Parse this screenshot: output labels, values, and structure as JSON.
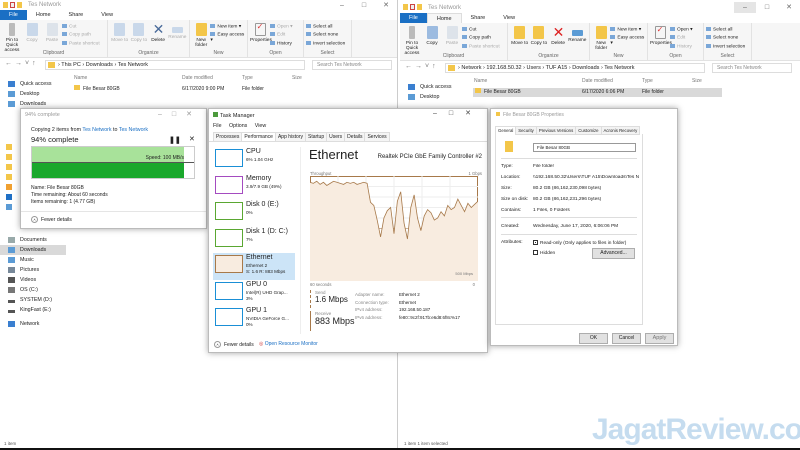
{
  "left_explorer": {
    "title": "Tes Network",
    "tabs": [
      "File",
      "Home",
      "Share",
      "View"
    ],
    "ribbon": {
      "clipboard": {
        "label": "Clipboard",
        "pin": "Pin to Quick access",
        "copy": "Copy",
        "paste": "Paste",
        "cut": "Cut",
        "copy_path": "Copy path",
        "paste_shortcut": "Paste shortcut"
      },
      "organize": {
        "label": "Organize",
        "move_to": "Move to",
        "copy_to": "Copy to",
        "delete": "Delete",
        "rename": "Rename"
      },
      "new": {
        "label": "New",
        "new_folder": "New folder",
        "new_item": "New item ▾",
        "easy_access": "Easy access ▾"
      },
      "open": {
        "label": "Open",
        "properties": "Properties",
        "open": "Open ▾",
        "edit": "Edit",
        "history": "History"
      },
      "select": {
        "label": "Select",
        "select_all": "Select all",
        "select_none": "Select none",
        "invert": "Invert selection"
      }
    },
    "breadcrumb": "›  This PC  ›  Downloads  ›  Tes Network",
    "search_placeholder": "Search Tes Network",
    "columns": [
      "Name",
      "Date modified",
      "Type",
      "Size"
    ],
    "files": [
      {
        "name": "File Besar 80GB",
        "date": "6/17/2020 9:00 PM",
        "type": "File folder",
        "size": ""
      }
    ],
    "sidebar": [
      "Quick access",
      "Desktop",
      "Downloads",
      "Documents",
      "Downloads",
      "Music",
      "Pictures",
      "Videos",
      "OS (C:)",
      "SYSTEM (D:)",
      "KingFast (E:)",
      "Network"
    ],
    "status": "1 item"
  },
  "right_explorer": {
    "title": "Tes Network",
    "tabs": [
      "File",
      "Home",
      "Share",
      "View"
    ],
    "breadcrumb": "›  Network  ›  192.168.50.32  ›  Users  ›  TUF A15  ›  Downloads  ›  Tes Network",
    "search_placeholder": "Search Tes Network",
    "files": [
      {
        "name": "File Besar 80GB",
        "date": "6/17/2020 6:06 PM",
        "type": "File folder"
      }
    ],
    "sidebar": [
      "Quick access",
      "Desktop"
    ],
    "status": "1 item     1 item selected"
  },
  "copy_dialog": {
    "title": "94% complete",
    "line_prefix": "Copying 2 items from ",
    "from": "Tes Network",
    "to_word": " to ",
    "to": "Tes Network",
    "heading": "94% complete",
    "progress": 0.94,
    "speed": "Speed: 100 MB/s",
    "name": "Name: File Besar 80GB",
    "time": "Time remaining: About 60 seconds",
    "items": "Items remaining: 1 (4.77 GB)",
    "fewer": "Fewer details"
  },
  "task_manager": {
    "title": "Task Manager",
    "menu": [
      "File",
      "Options",
      "View"
    ],
    "tabs": [
      "Processes",
      "Performance",
      "App history",
      "Startup",
      "Users",
      "Details",
      "Services"
    ],
    "items": [
      {
        "name": "CPU",
        "sub": "6% 1.04 GHz",
        "color": "#1a8fd6"
      },
      {
        "name": "Memory",
        "sub": "3.9/7.9 GB (49%)",
        "color": "#a44bc0"
      },
      {
        "name": "Disk 0 (E:)",
        "sub": "0%",
        "color": "#5aa732"
      },
      {
        "name": "Disk 1 (D: C:)",
        "sub": "7%",
        "color": "#5aa732"
      },
      {
        "name": "Ethernet",
        "sub": "Ethernet 2",
        "sub2": "S: 1.6 R: 883 Mbps",
        "color": "#a7794a"
      },
      {
        "name": "GPU 0",
        "sub": "Intel(R) UHD Grap...",
        "sub2": "3%",
        "color": "#1a8fd6"
      },
      {
        "name": "GPU 1",
        "sub": "NVIDIA GeForce G...",
        "sub2": "0%",
        "color": "#1a8fd6"
      }
    ],
    "heading": "Ethernet",
    "adapter": "Realtek PCIe GbE Family Controller #2",
    "graph_label": "Throughput",
    "graph_max": "1 Gbps",
    "graph_mid": "500 Mbps",
    "graph_left": "60 seconds",
    "graph_right": "0",
    "throughput_pct": [
      94,
      93,
      95,
      92,
      94,
      91,
      93,
      95,
      94,
      93,
      92,
      94,
      93,
      94,
      92,
      93,
      94,
      93,
      75,
      72,
      58,
      42,
      60,
      67,
      70,
      45,
      76,
      85,
      55,
      40,
      70,
      82,
      60,
      48,
      62,
      68,
      65,
      58,
      60,
      66,
      62,
      72,
      68,
      70,
      78,
      72,
      66,
      74,
      70,
      73,
      76
    ],
    "send_label": "Send",
    "send": "1.6 Mbps",
    "receive_label": "Receive",
    "receive": "883 Mbps",
    "details": [
      [
        "Adapter name:",
        "Ethernet 2"
      ],
      [
        "Connection type:",
        "Ethernet"
      ],
      [
        "IPv4 address:",
        "192.168.50.187"
      ],
      [
        "IPv6 address:",
        "fe80::9c2f:917b:e6d8:6f8c%17"
      ]
    ],
    "fewer": "Fewer details",
    "resmon": "Open Resource Monitor"
  },
  "properties": {
    "title": "File Besar 80GB Properties",
    "tabs": [
      "General",
      "Security",
      "Previous Versions",
      "Customize",
      "Acronis Recovery"
    ],
    "name": "File Besar 80GB",
    "rows": [
      [
        "Type:",
        "File folder"
      ],
      [
        "Location:",
        "\\\\192.168.50.32\\Users\\TUF A15\\Downloads\\Tes N"
      ],
      [
        "Size:",
        "80.2 GB (86,162,230,098 bytes)"
      ],
      [
        "Size on disk:",
        "80.2 GB (86,162,231,296 bytes)"
      ],
      [
        "Contains:",
        "1 Files, 0 Folders"
      ]
    ],
    "created_label": "Created:",
    "created": "Wednesday, June 17, 2020, 6:06:06 PM",
    "attributes_label": "Attributes:",
    "readonly": "Read-only (Only applies to files in folder)",
    "hidden": "Hidden",
    "advanced": "Advanced...",
    "ok": "OK",
    "cancel": "Cancel",
    "apply": "Apply"
  },
  "watermark": "JagatReview.com"
}
